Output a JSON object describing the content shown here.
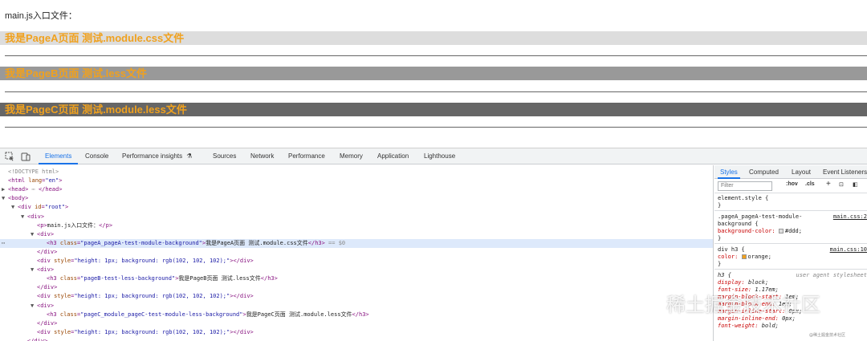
{
  "page": {
    "intro": "main.js入口文件：",
    "headings": [
      {
        "text": "我是PageA页面 测试.module.css文件",
        "bg": "#dddddd"
      },
      {
        "text": "我是PageB页面 测试.less文件",
        "bg": "#999999"
      },
      {
        "text": "我是PageC页面 测试.module.less文件",
        "bg": "#666666"
      }
    ],
    "heading_color": "#f0a11e"
  },
  "devtools": {
    "tabs": [
      "Elements",
      "Console",
      "Performance insights",
      "Sources",
      "Network",
      "Performance",
      "Memory",
      "Application",
      "Lighthouse"
    ],
    "active_tab": "Elements",
    "dom": [
      {
        "indent": 0,
        "tri": "",
        "parts": [
          [
            "dim",
            "<!DOCTYPE html>"
          ]
        ]
      },
      {
        "indent": 0,
        "tri": "",
        "parts": [
          [
            "tag",
            "<html"
          ],
          [
            "attr",
            " lang"
          ],
          [
            "tag",
            "="
          ],
          [
            "val",
            "\"en\""
          ],
          [
            "tag",
            ">"
          ]
        ]
      },
      {
        "indent": 0,
        "tri": "▶",
        "parts": [
          [
            "tag",
            "<head>"
          ],
          [
            "dim",
            " ⋯ "
          ],
          [
            "tag",
            "</head>"
          ]
        ]
      },
      {
        "indent": 0,
        "tri": "▼",
        "parts": [
          [
            "tag",
            "<body>"
          ]
        ]
      },
      {
        "indent": 1,
        "tri": "▼",
        "parts": [
          [
            "tag",
            "<div"
          ],
          [
            "attr",
            " id"
          ],
          [
            "tag",
            "="
          ],
          [
            "val",
            "\"root\""
          ],
          [
            "tag",
            ">"
          ]
        ]
      },
      {
        "indent": 2,
        "tri": "▼",
        "parts": [
          [
            "tag",
            "<div>"
          ]
        ]
      },
      {
        "indent": 3,
        "tri": "",
        "parts": [
          [
            "tag",
            "<p>"
          ],
          [
            "txt",
            "main.js入口文件："
          ],
          [
            "tag",
            "</p>"
          ]
        ]
      },
      {
        "indent": 3,
        "tri": "▼",
        "parts": [
          [
            "tag",
            "<div>"
          ]
        ]
      },
      {
        "indent": 4,
        "tri": "",
        "selected": true,
        "parts": [
          [
            "tag",
            "<h3"
          ],
          [
            "attr",
            " class"
          ],
          [
            "tag",
            "="
          ],
          [
            "val",
            "\"pageA_pageA-test-module-background\""
          ],
          [
            "tag",
            ">"
          ],
          [
            "txt",
            "我是PageA页面 测试.module.css文件"
          ],
          [
            "tag",
            "</h3>"
          ],
          [
            "dim",
            " == $0"
          ]
        ]
      },
      {
        "indent": 3,
        "tri": "",
        "parts": [
          [
            "tag",
            "</div>"
          ]
        ]
      },
      {
        "indent": 3,
        "tri": "",
        "parts": [
          [
            "tag",
            "<div"
          ],
          [
            "attr",
            " style"
          ],
          [
            "tag",
            "="
          ],
          [
            "val",
            "\"height: 1px; background: rgb(102, 102, 102);\""
          ],
          [
            "tag",
            "></div>"
          ]
        ]
      },
      {
        "indent": 3,
        "tri": "▼",
        "parts": [
          [
            "tag",
            "<div>"
          ]
        ]
      },
      {
        "indent": 4,
        "tri": "",
        "parts": [
          [
            "tag",
            "<h3"
          ],
          [
            "attr",
            " class"
          ],
          [
            "tag",
            "="
          ],
          [
            "val",
            "\"pageB-test-less-background\""
          ],
          [
            "tag",
            ">"
          ],
          [
            "txt",
            "我是PageB页面 测试.less文件"
          ],
          [
            "tag",
            "</h3>"
          ]
        ]
      },
      {
        "indent": 3,
        "tri": "",
        "parts": [
          [
            "tag",
            "</div>"
          ]
        ]
      },
      {
        "indent": 3,
        "tri": "",
        "parts": [
          [
            "tag",
            "<div"
          ],
          [
            "attr",
            " style"
          ],
          [
            "tag",
            "="
          ],
          [
            "val",
            "\"height: 1px; background: rgb(102, 102, 102);\""
          ],
          [
            "tag",
            "></div>"
          ]
        ]
      },
      {
        "indent": 3,
        "tri": "▼",
        "parts": [
          [
            "tag",
            "<div>"
          ]
        ]
      },
      {
        "indent": 4,
        "tri": "",
        "parts": [
          [
            "tag",
            "<h3"
          ],
          [
            "attr",
            " class"
          ],
          [
            "tag",
            "="
          ],
          [
            "val",
            "\"pageC_module_pageC-test-module-less-background\""
          ],
          [
            "tag",
            ">"
          ],
          [
            "txt",
            "我是PageC页面 测试.module.less文件"
          ],
          [
            "tag",
            "</h3>"
          ]
        ]
      },
      {
        "indent": 3,
        "tri": "",
        "parts": [
          [
            "tag",
            "</div>"
          ]
        ]
      },
      {
        "indent": 3,
        "tri": "",
        "parts": [
          [
            "tag",
            "<div"
          ],
          [
            "attr",
            " style"
          ],
          [
            "tag",
            "="
          ],
          [
            "val",
            "\"height: 1px; background: rgb(102, 102, 102);\""
          ],
          [
            "tag",
            "></div>"
          ]
        ]
      },
      {
        "indent": 2,
        "tri": "",
        "parts": [
          [
            "tag",
            "</div>"
          ]
        ]
      }
    ],
    "styles_tabs": [
      "Styles",
      "Computed",
      "Layout",
      "Event Listeners"
    ],
    "styles_active": "Styles",
    "filter_placeholder": "Filter",
    "hov_label": ":hov",
    "cls_label": ".cls",
    "rules": [
      {
        "lines": [
          [
            "sel",
            "element.style {"
          ],
          [
            "sel",
            "}"
          ]
        ],
        "source": ""
      },
      {
        "lines": [
          [
            "sel",
            ".pageA_pageA-test-module-"
          ],
          [
            "sel",
            "background {"
          ],
          [
            "prop",
            "  background-color: ",
            "#ddd;"
          ],
          [
            "sel",
            "}"
          ]
        ],
        "source": "main.css:2"
      },
      {
        "lines": [
          [
            "sel",
            "div h3 {"
          ],
          [
            "prop",
            "  color: ",
            "orange;"
          ],
          [
            "sel",
            "}"
          ]
        ],
        "source": "main.css:10"
      },
      {
        "lines": [
          [
            "sel",
            "h3 {"
          ],
          [
            "prop",
            "  display: ",
            "block;"
          ],
          [
            "prop",
            "  font-size: ",
            "1.17em;"
          ],
          [
            "prop",
            "  margin-block-start: ",
            "1em;"
          ],
          [
            "prop",
            "  margin-block-end: ",
            "1em;"
          ],
          [
            "prop",
            "  margin-inline-start: ",
            "0px;"
          ],
          [
            "prop",
            "  margin-inline-end: ",
            "0px;"
          ],
          [
            "prop",
            "  font-weight: ",
            "bold;"
          ]
        ],
        "source": "user agent stylesheet",
        "ua": true
      }
    ],
    "swatch_colors": {
      "ddd": "#dddddd",
      "orange": "#f0a11e"
    }
  },
  "watermark": {
    "text": "稀土掘金技术社区",
    "small": "@稀土掘金技术社区"
  }
}
